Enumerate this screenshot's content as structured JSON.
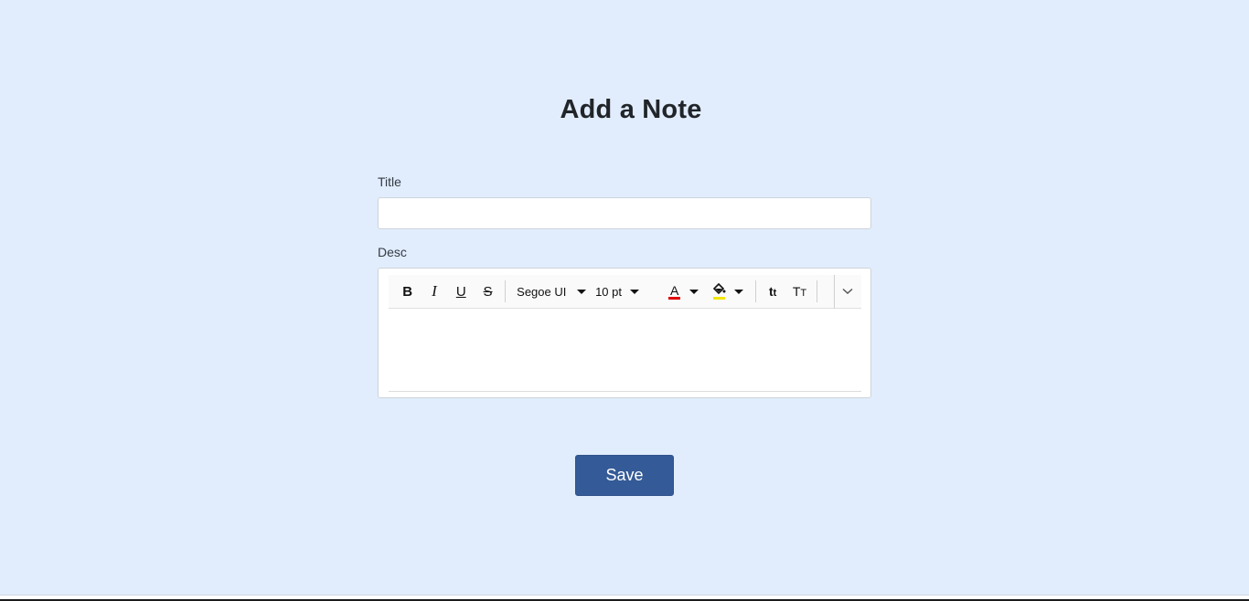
{
  "page": {
    "heading": "Add a Note"
  },
  "form": {
    "title_label": "Title",
    "title_value": "",
    "desc_label": "Desc",
    "save_label": "Save"
  },
  "editor_toolbar": {
    "bold_glyph": "B",
    "italic_glyph": "I",
    "underline_glyph": "U",
    "strike_glyph": "S",
    "font_family_value": "Segoe UI",
    "font_size_value": "10 pt",
    "font_color_glyph": "A",
    "font_color": "#e00000",
    "highlight_color": "#f2e600",
    "icons": [
      "bold-icon",
      "italic-icon",
      "underline-icon",
      "strikethrough-icon",
      "font-color-icon",
      "highlight-icon",
      "lowercase-icon",
      "uppercase-icon",
      "more-chevron-icon"
    ]
  },
  "colors": {
    "background": "#e1edfd",
    "primary_button": "#345b97"
  }
}
